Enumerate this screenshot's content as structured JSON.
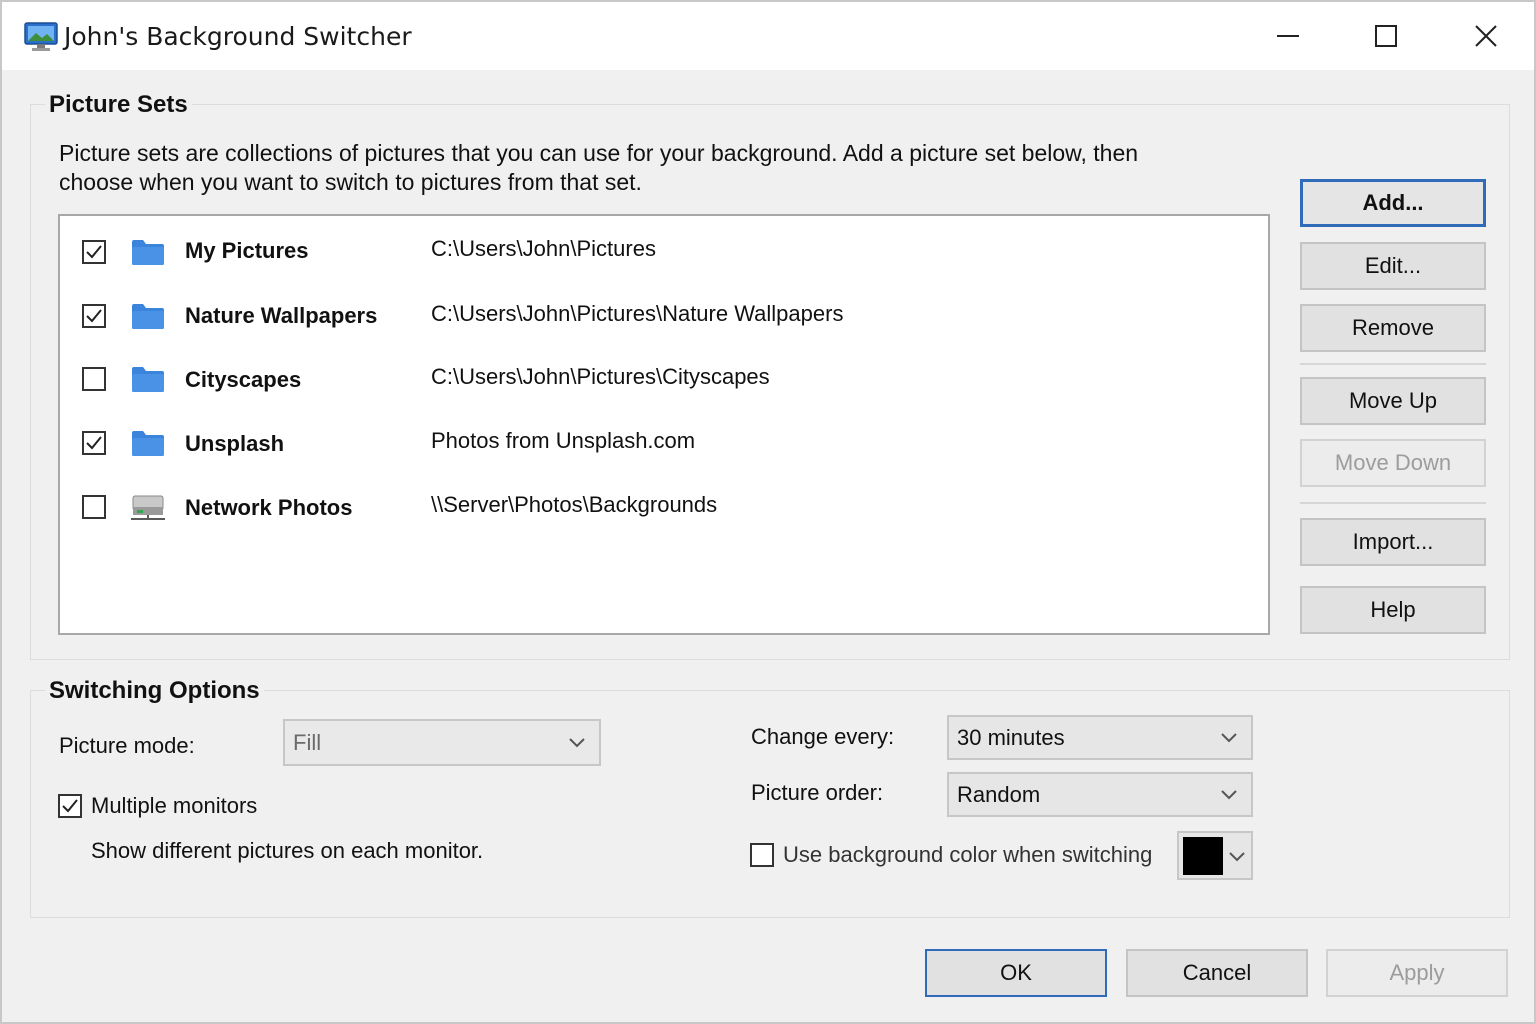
{
  "window": {
    "title": "John's Background Switcher",
    "icon": "monitor-icon",
    "controls": [
      "minimize-icon",
      "maximize-icon",
      "close-icon"
    ]
  },
  "picture_sets": {
    "title": "Picture Sets",
    "description_line1": "Picture sets are collections of pictures that you can use for your background. Add a picture set below, then",
    "description_line2": "choose when you want to switch to pictures from that set.",
    "items": [
      {
        "checked": true,
        "icon": "folder-icon",
        "name": "My Pictures",
        "path": "C:\\Users\\John\\Pictures"
      },
      {
        "checked": true,
        "icon": "folder-icon",
        "name": "Nature Wallpapers",
        "path": "C:\\Users\\John\\Pictures\\Nature Wallpapers"
      },
      {
        "checked": false,
        "icon": "folder-icon",
        "name": "Cityscapes",
        "path": "C:\\Users\\John\\Pictures\\Cityscapes"
      },
      {
        "checked": true,
        "icon": "folder-icon",
        "name": "Unsplash",
        "path": "Photos from Unsplash.com"
      },
      {
        "checked": false,
        "icon": "network-drive-icon",
        "name": "Network Photos",
        "path": "\\\\Server\\Photos\\Backgrounds"
      }
    ],
    "buttons": {
      "add": "Add...",
      "edit": "Edit...",
      "remove": "Remove",
      "move_up": "Move Up",
      "move_down": "Move Down",
      "import": "Import...",
      "help": "Help"
    }
  },
  "switching": {
    "title": "Switching Options",
    "picture_mode_label": "Picture mode:",
    "picture_mode_value": "Fill",
    "multiple_monitors_label": "Multiple monitors",
    "multiple_monitors_checked": true,
    "multiple_monitors_desc": "Show different pictures on each monitor.",
    "change_every_label": "Change every:",
    "change_every_value": "30 minutes",
    "picture_order_label": "Picture order:",
    "picture_order_value": "Random",
    "bg_color_label": "Use background color when switching",
    "bg_color_checked": false,
    "bg_color_value": "#000000"
  },
  "footer": {
    "ok": "OK",
    "cancel": "Cancel",
    "apply": "Apply"
  },
  "colors": {
    "accent": "#2f6bb8",
    "folder": "#3a84dc"
  }
}
